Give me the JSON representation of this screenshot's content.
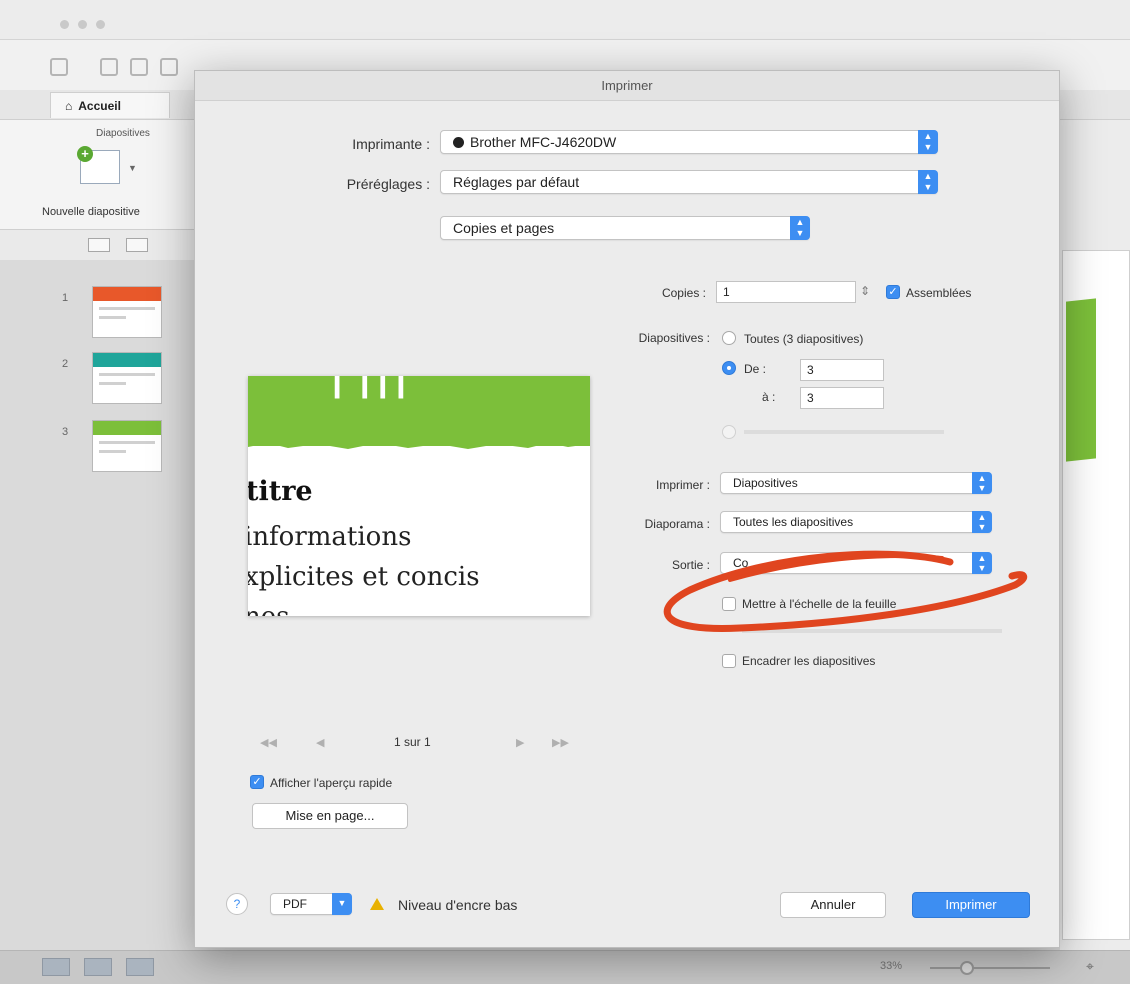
{
  "app": {
    "home_tab": "Accueil",
    "group_title": "Diapositives",
    "new_slide_label": "Nouvelle diapositive",
    "thumbnails": [
      {
        "num": "1",
        "band_color": "#e8582a"
      },
      {
        "num": "2",
        "band_color": "#1fa59a"
      },
      {
        "num": "3",
        "band_color": "#7cbf3a"
      }
    ],
    "zoom_label": "33%"
  },
  "dialog": {
    "title": "Imprimer",
    "printer_label": "Imprimante :",
    "printer_value": "Brother MFC-J4620DW",
    "presets_label": "Préréglages :",
    "presets_value": "Réglages par défaut",
    "section_value": "Copies et pages",
    "copies_label": "Copies :",
    "copies_value": "1",
    "collated_label": "Assemblées",
    "collated_checked": true,
    "slides_label": "Diapositives :",
    "all_slides_label": "Toutes (3 diapositives)",
    "from_label": "De :",
    "from_value": "3",
    "to_label": "à :",
    "to_value": "3",
    "print_label": "Imprimer :",
    "print_value": "Diapositives",
    "slideshow_label": "Diaporama :",
    "slideshow_value": "Toutes les diapositives",
    "output_label": "Sortie :",
    "output_value": "Co",
    "scale_label": "Mettre à l'échelle de la feuille",
    "frame_label": "Encadrer les diapositives",
    "page_indicator": "1 sur 1",
    "quick_preview_label": "Afficher l'aperçu rapide",
    "page_setup_label": "Mise en page...",
    "help_label": "?",
    "pdf_label": "PDF",
    "ink_warning": "Niveau d'encre bas",
    "cancel_label": "Annuler",
    "print_button_label": "Imprimer"
  },
  "preview": {
    "title": "titre",
    "lines": [
      "informations",
      "xplicites et concis",
      "nes"
    ]
  },
  "colors": {
    "accent": "#3d8ef2",
    "preview_green": "#7cbf3a",
    "annotation": "#e0451f"
  }
}
